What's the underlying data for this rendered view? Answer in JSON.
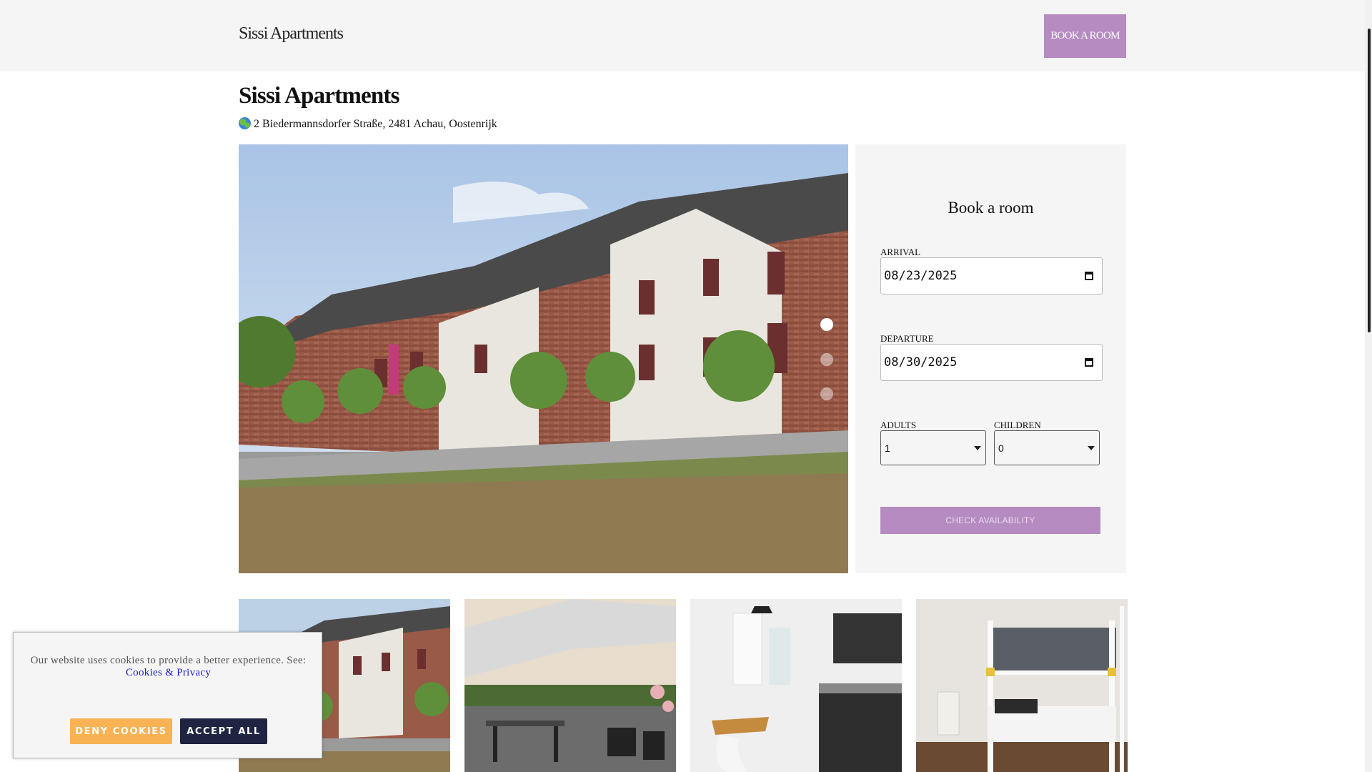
{
  "header": {
    "brand": "Sissi Apartments",
    "book_button": "BOOK A ROOM"
  },
  "property": {
    "title": "Sissi Apartments",
    "address": "2 Biedermannsdorfer Straße, 2481 Achau, Oostenrijk",
    "address_icon": "globe-icon"
  },
  "hero": {
    "slides": 3,
    "active_slide": 1,
    "image": "apartment-building-exterior"
  },
  "booking": {
    "title": "Book a room",
    "arrival_label": "ARRIVAL",
    "arrival_value": "08/23/2025",
    "departure_label": "DEPARTURE",
    "departure_value": "08/30/2025",
    "adults_label": "ADULTS",
    "adults_value": "1",
    "children_label": "CHILDREN",
    "children_value": "0",
    "check_button": "CHECK AVAILABILITY"
  },
  "gallery": [
    {
      "image": "building-exterior"
    },
    {
      "image": "terrace-with-umbrella"
    },
    {
      "image": "kitchenette"
    },
    {
      "image": "bunk-bed-room"
    }
  ],
  "cookie_banner": {
    "text": "Our website uses cookies to provide a better experience. See:",
    "link": "Cookies & Privacy",
    "deny_button": "DENY COOKIES",
    "accept_button": "ACCEPT ALL"
  },
  "colors": {
    "accent": "#b58bc1",
    "deny": "#f9b254",
    "accept": "#1e2441",
    "panel": "#f5f5f5"
  }
}
